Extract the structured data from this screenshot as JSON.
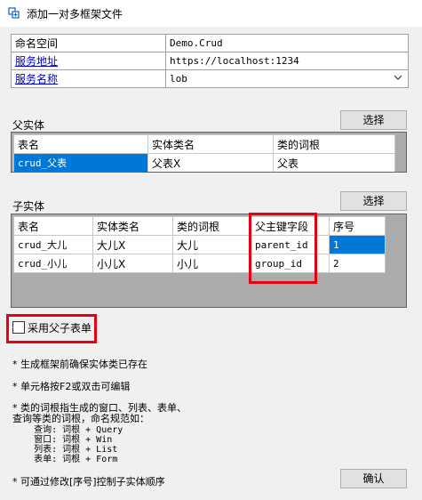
{
  "window": {
    "title": "添加一对多框架文件",
    "icon": "add-file-icon"
  },
  "props": {
    "namespace_label": "命名空间",
    "namespace_value": "Demo.Crud",
    "service_url_label": "服务地址",
    "service_url_value": "https://localhost:1234",
    "service_name_label": "服务名称",
    "service_name_value": "lob"
  },
  "parent": {
    "label": "父实体",
    "select_button": "选择",
    "columns": [
      "表名",
      "实体类名",
      "类的词根"
    ],
    "rows": [
      {
        "table": "crud_父表",
        "entity": "父表X",
        "root": "父表"
      }
    ]
  },
  "child": {
    "label": "子实体",
    "select_button": "选择",
    "columns": [
      "表名",
      "实体类名",
      "类的词根",
      "父主键字段",
      "序号"
    ],
    "rows": [
      {
        "table": "crud_大儿",
        "entity": "大儿X",
        "root": "大儿",
        "parent_key": "parent_id",
        "order": "1"
      },
      {
        "table": "crud_小儿",
        "entity": "小儿X",
        "root": "小儿",
        "parent_key": "group_id",
        "order": "2"
      }
    ]
  },
  "options": {
    "use_parent_child_form_label": "采用父子表单",
    "use_parent_child_form_checked": false
  },
  "notes": {
    "n1": "* 生成框架前确保实体类已存在",
    "n2": "* 单元格按F2或双击可编辑",
    "n3_line1": "* 类的词根指生成的窗口、列表、表单、",
    "n3_line2": "  查询等类的词根，命名规范如：",
    "n3_examples": "    查询: 词根 + Query\n    窗口: 词根 + Win\n    列表: 词根 + List\n    表单: 词根 + Form",
    "n4": "* 可通过修改[序号]控制子实体顺序"
  },
  "confirm_button": "确认",
  "colors": {
    "selection": "#0078d7",
    "highlight_box": "#e60012",
    "link": "#0000cc"
  }
}
